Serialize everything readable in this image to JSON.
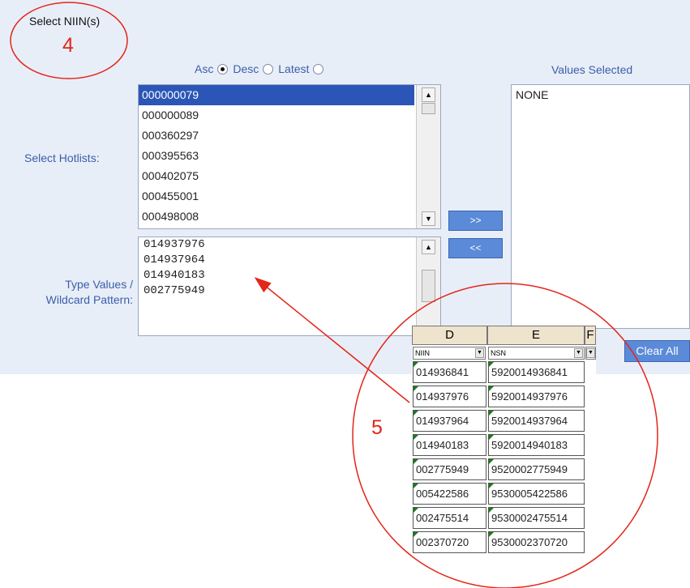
{
  "panel": {
    "select_title": "Select NIIN(s)",
    "sort": {
      "asc_label": "Asc",
      "desc_label": "Desc",
      "latest_label": "Latest",
      "selected": "Asc"
    },
    "values_title": "Values Selected",
    "hotlists_label": "Select Hotlists:",
    "type_label": "Type Values /\nWildcard Pattern:",
    "hotlist_items": [
      "000000079",
      "000000089",
      "000360297",
      "000395563",
      "000402075",
      "000455001",
      "000498008"
    ],
    "hotlist_selected_index": 0,
    "typed_values": [
      "014937976",
      "014937964",
      "014940183",
      "002775949"
    ],
    "add_button": ">>",
    "remove_button": "<<",
    "selected_values": [
      "NONE"
    ],
    "clear_button": "Clear All"
  },
  "callouts": {
    "step4": "4",
    "step5": "5"
  },
  "spreadsheet": {
    "columns": [
      "D",
      "E",
      "F"
    ],
    "headers": [
      "NIIN",
      "NSN"
    ],
    "rows": [
      [
        "014936841",
        "5920014936841"
      ],
      [
        "014937976",
        "5920014937976"
      ],
      [
        "014937964",
        "5920014937964"
      ],
      [
        "014940183",
        "5920014940183"
      ],
      [
        "002775949",
        "9520002775949"
      ],
      [
        "005422586",
        "9530005422586"
      ],
      [
        "002475514",
        "9530002475514"
      ],
      [
        "002370720",
        "9530002370720"
      ]
    ]
  },
  "colors": {
    "panel_bg": "#e8eef8",
    "label_blue": "#3a5ea8",
    "button_blue": "#5b8ad8",
    "annotation_red": "#e3261a",
    "selection": "#2b56b8"
  }
}
